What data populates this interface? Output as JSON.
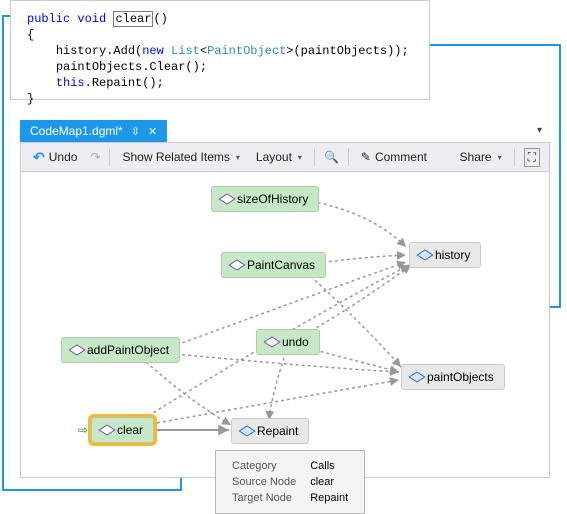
{
  "code": {
    "kw_public": "public",
    "kw_void": "void",
    "method_name": "clear",
    "paren_sig": "()",
    "brace_open": "{",
    "line2_a": "history.Add(",
    "kw_new": "new",
    "type_list": "List",
    "type_angle": "<",
    "type_paint": "PaintObject",
    "line2_b": ">(paintObjects));",
    "line3": "paintObjects.Clear();",
    "kw_this": "this",
    "line4_b": ".Repaint();",
    "brace_close": "}"
  },
  "tab": {
    "title": "CodeMap1.dgml*",
    "pin_glyph": "⇳",
    "close_glyph": "✕"
  },
  "tab_right_chevron": "▾",
  "toolbar": {
    "undo_glyph": "↶",
    "undo_label": "Undo",
    "redo_glyph": "↷",
    "show_related": "Show Related Items",
    "layout": "Layout",
    "search_glyph": "🔍",
    "comment_glyph": "✎",
    "comment_label": "Comment",
    "share": "Share",
    "fit_glyph": "⛶"
  },
  "graph": {
    "nodes": {
      "sizeOfHistory": "sizeOfHistory",
      "PaintCanvas": "PaintCanvas",
      "addPaintObject": "addPaintObject",
      "undo": "undo",
      "clear": "clear",
      "history": "history",
      "paintObjects": "paintObjects",
      "Repaint": "Repaint"
    },
    "start_arrow": "⇨"
  },
  "tooltip": {
    "k1": "Category",
    "v1": "Calls",
    "k2": "Source Node",
    "v2": "clear",
    "k3": "Target Node",
    "v3": "Repaint"
  }
}
